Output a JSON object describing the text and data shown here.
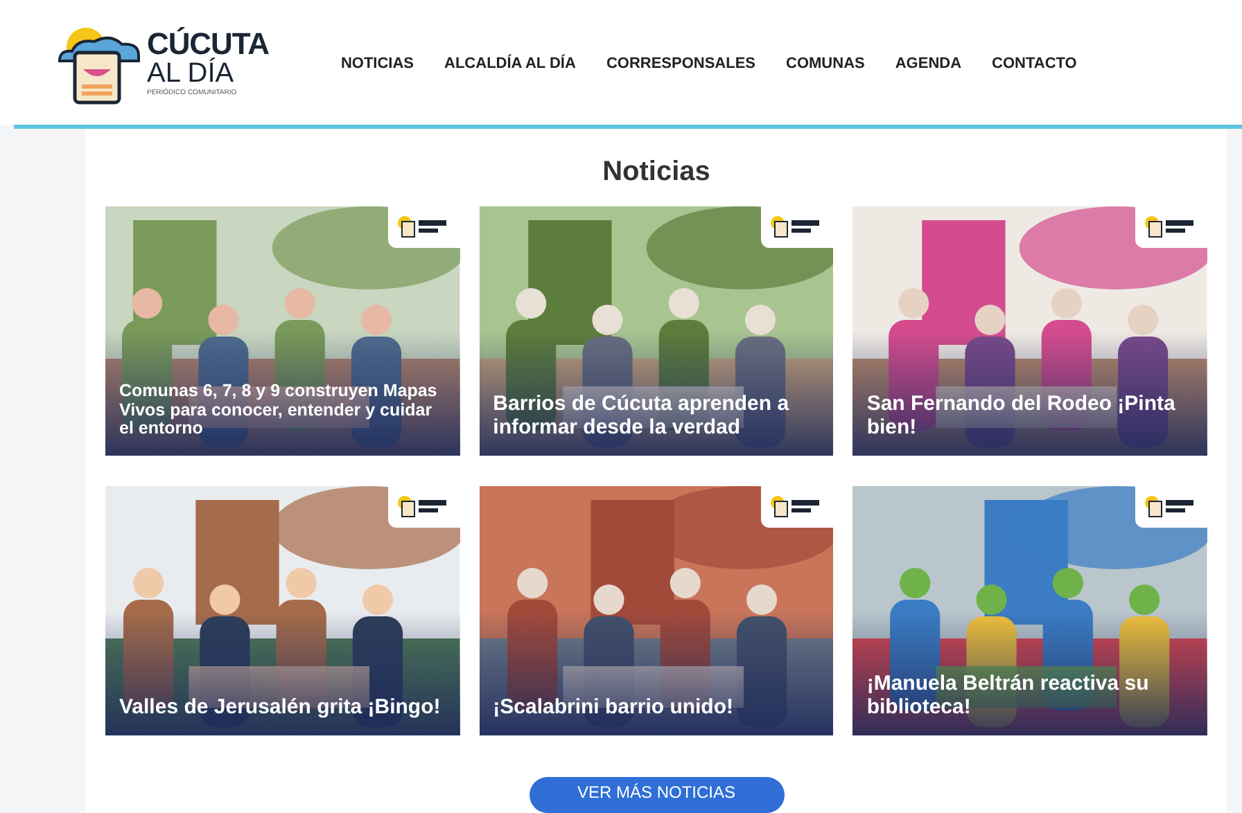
{
  "logo": {
    "name": "CÚCUTA",
    "name_line2": "AL DÍA",
    "tagline": "PERIÓDICO COMUNITARIO"
  },
  "nav": [
    {
      "label": "NOTICIAS"
    },
    {
      "label": "ALCALDÍA AL DÍA"
    },
    {
      "label": "CORRESPONSALES"
    },
    {
      "label": "COMUNAS"
    },
    {
      "label": "AGENDA"
    },
    {
      "label": "CONTACTO"
    }
  ],
  "section_title": "Noticias",
  "articles": [
    {
      "title": "Comunas 6, 7, 8 y 9 construyen Mapas Vivos para conocer, entender y cuidar el entorno",
      "kind": "picture"
    },
    {
      "title": "Barrios de Cúcuta aprenden a informar desde la verdad",
      "kind": "picture"
    },
    {
      "title": "San Fernando del Rodeo ¡Pinta bien!",
      "kind": "picture"
    },
    {
      "title": "Valles de Jerusalén grita ¡Bingo!",
      "kind": "picture"
    },
    {
      "title": "¡Scalabrini barrio unido!",
      "kind": "picture"
    },
    {
      "title": "¡Manuela Beltrán reactiva su biblioteca!",
      "kind": "picture"
    }
  ],
  "more_button": "VER MÁS NOTICIAS"
}
